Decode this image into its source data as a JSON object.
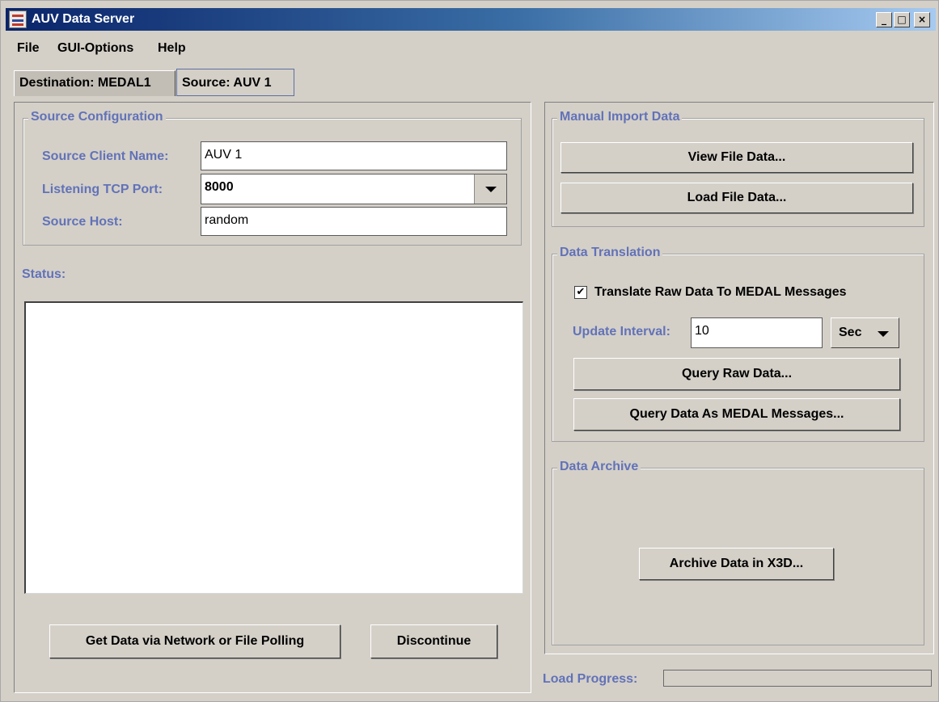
{
  "window": {
    "title": "AUV Data Server"
  },
  "menu": {
    "file": "File",
    "gui_options": "GUI-Options",
    "help": "Help"
  },
  "tabs": {
    "destination": "Destination: MEDAL1",
    "source": "Source: AUV 1"
  },
  "source_config": {
    "title": "Source Configuration",
    "client_name_label": "Source Client Name:",
    "client_name_value": "AUV 1",
    "tcp_port_label": "Listening TCP Port:",
    "tcp_port_value": "8000",
    "host_label": "Source Host:",
    "host_value": "random"
  },
  "status": {
    "label": "Status:"
  },
  "buttons": {
    "get_data": "Get Data via Network or File Polling",
    "discontinue": "Discontinue"
  },
  "manual_import": {
    "title": "Manual Import Data",
    "view_file": "View File Data...",
    "load_file": "Load File Data..."
  },
  "translation": {
    "title": "Data Translation",
    "translate_checkbox_label": "Translate Raw Data To MEDAL Messages",
    "translate_checked": "✔",
    "update_interval_label": "Update Interval:",
    "update_interval_value": "10",
    "unit_value": "Sec",
    "query_raw": "Query Raw Data...",
    "query_medal": "Query Data As MEDAL Messages..."
  },
  "archive": {
    "title": "Data Archive",
    "archive_x3d": "Archive Data in X3D..."
  },
  "load_progress": {
    "label": "Load Progress:",
    "value": 0
  },
  "colors": {
    "title_start": "#0a246a",
    "label_blue": "#6272b8",
    "window_bg": "#d4d0c8"
  },
  "icons": {
    "app": "auv-app-icon",
    "minimize": "minimize-icon",
    "maximize": "maximize-icon",
    "close": "close-icon",
    "dropdown": "chevron-down-icon",
    "checkbox": "checkmark-icon"
  }
}
